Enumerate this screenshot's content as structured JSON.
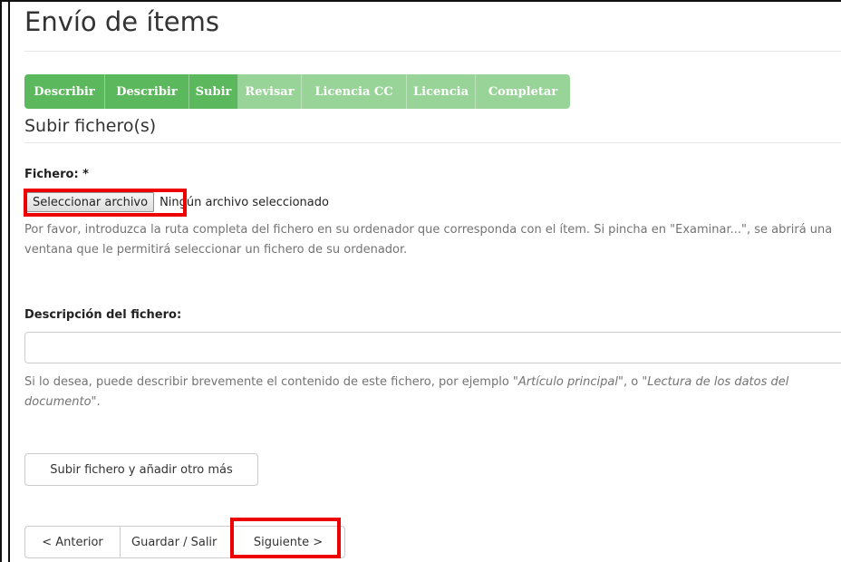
{
  "page": {
    "title": "Envío de ítems",
    "section_title": "Subir fichero(s)"
  },
  "steps": [
    {
      "label": "Describir",
      "state": "done"
    },
    {
      "label": "Describir",
      "state": "done"
    },
    {
      "label": "Subir",
      "state": "done"
    },
    {
      "label": "Revisar",
      "state": "pending"
    },
    {
      "label": "Licencia CC",
      "state": "pending"
    },
    {
      "label": "Licencia",
      "state": "pending"
    },
    {
      "label": "Completar",
      "state": "pending"
    }
  ],
  "file_field": {
    "label": "Fichero: *",
    "button_label": "Seleccionar archivo",
    "status": "Ningún archivo seleccionado",
    "help": "Por favor, introduzca la ruta completa del fichero en su ordenador que corresponda con el ítem. Si pincha en \"Examinar...\", se abrirá una ventana que le permitirá seleccionar un fichero de su ordenador."
  },
  "description_field": {
    "label": "Descripción del fichero:",
    "value": "",
    "help_prefix": "Si lo desea, puede describir brevemente el contenido de este fichero, por ejemplo \"",
    "help_example1": "Artículo principal",
    "help_middle": "\", o \"",
    "help_example2": "Lectura de los datos del documento",
    "help_suffix": "\"."
  },
  "actions": {
    "upload_another": "Subir fichero y añadir otro más",
    "previous": "< Anterior",
    "save_exit": "Guardar / Salir",
    "next": "Siguiente >"
  },
  "colors": {
    "step_done": "#5cb85c",
    "step_pending": "#98d398",
    "highlight": "#ee0000"
  }
}
